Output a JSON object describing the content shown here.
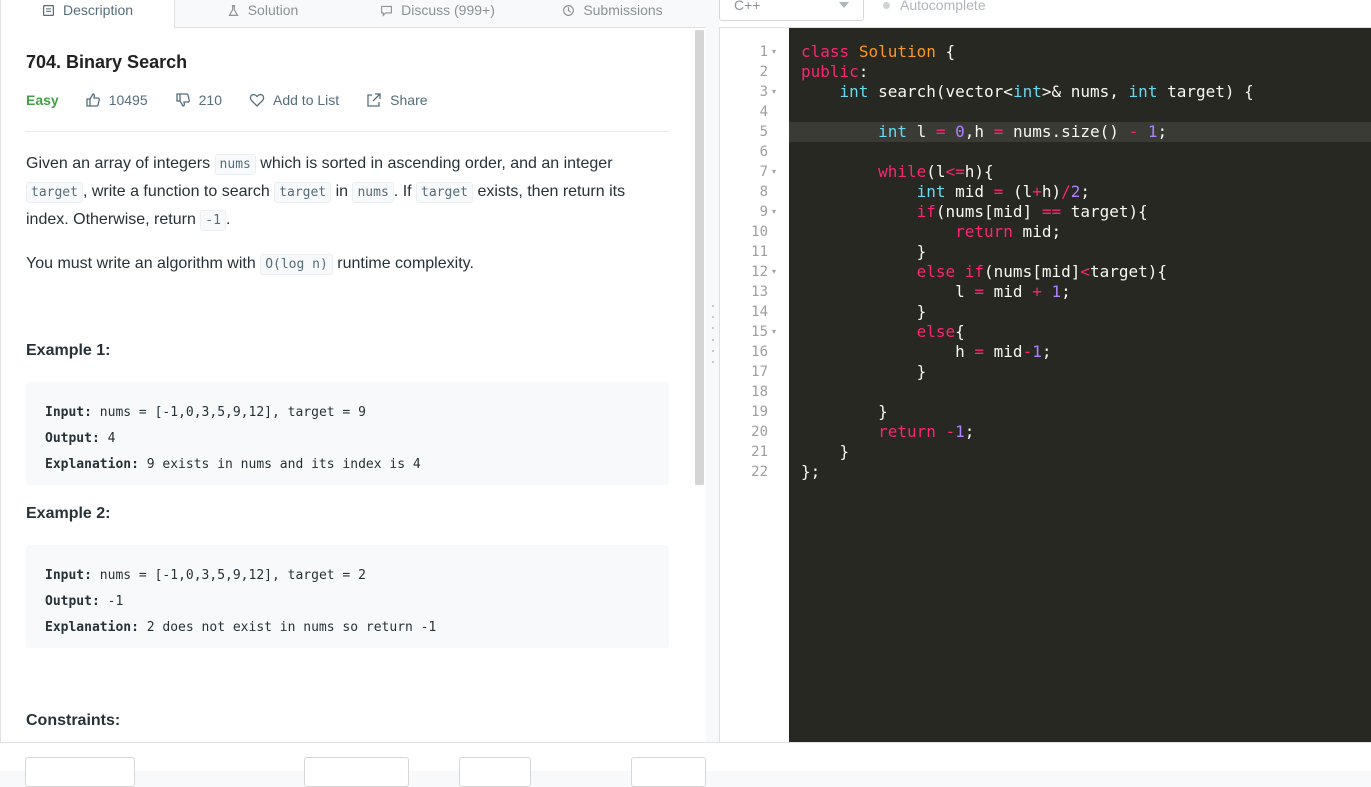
{
  "tabs": [
    {
      "label": "Description",
      "icon": "description-icon"
    },
    {
      "label": "Solution",
      "icon": "flask-icon"
    },
    {
      "label": "Discuss (999+)",
      "icon": "chat-icon"
    },
    {
      "label": "Submissions",
      "icon": "clock-icon"
    }
  ],
  "problem": {
    "title": "704. Binary Search",
    "difficulty": "Easy",
    "likes": "10495",
    "dislikes": "210",
    "add_to_list": "Add to List",
    "share": "Share"
  },
  "description": {
    "p1": [
      {
        "t": "text",
        "v": "Given an array of integers "
      },
      {
        "t": "code",
        "v": "nums"
      },
      {
        "t": "text",
        "v": " which is sorted in ascending order, and an integer "
      },
      {
        "t": "code",
        "v": "target"
      },
      {
        "t": "text",
        "v": ", write a function to search "
      },
      {
        "t": "code",
        "v": "target"
      },
      {
        "t": "text",
        "v": " in "
      },
      {
        "t": "code",
        "v": "nums"
      },
      {
        "t": "text",
        "v": ". If "
      },
      {
        "t": "code",
        "v": "target"
      },
      {
        "t": "text",
        "v": " exists, then return its index. Otherwise, return "
      },
      {
        "t": "code",
        "v": "-1"
      },
      {
        "t": "text",
        "v": "."
      }
    ],
    "p2": [
      {
        "t": "text",
        "v": "You must write an algorithm with "
      },
      {
        "t": "code",
        "v": "O(log n)"
      },
      {
        "t": "text",
        "v": " runtime complexity."
      }
    ]
  },
  "examples": [
    {
      "heading": "Example 1:",
      "input_label": "Input:",
      "input": "nums = [-1,0,3,5,9,12], target = 9",
      "output_label": "Output:",
      "output": "4",
      "explanation_label": "Explanation:",
      "explanation": "9 exists in nums and its index is 4"
    },
    {
      "heading": "Example 2:",
      "input_label": "Input:",
      "input": "nums = [-1,0,3,5,9,12], target = 2",
      "output_label": "Output:",
      "output": "-1",
      "explanation_label": "Explanation:",
      "explanation": "2 does not exist in nums so return -1"
    }
  ],
  "constraints_heading": "Constraints:",
  "editor": {
    "language": "C++",
    "autocomplete": "Autocomplete",
    "highlighted_line": 5,
    "fold_lines": [
      1,
      3,
      7,
      9,
      12,
      15
    ],
    "lines": [
      [
        [
          "kw",
          "class"
        ],
        [
          "t",
          " "
        ],
        [
          "cl",
          "Solution"
        ],
        [
          "t",
          " {"
        ]
      ],
      [
        [
          "kw",
          "public"
        ],
        [
          "t",
          ":"
        ]
      ],
      [
        [
          "t",
          "    "
        ],
        [
          "ty",
          "int"
        ],
        [
          "t",
          " search(vector<"
        ],
        [
          "ty",
          "int"
        ],
        [
          "t",
          ">& nums, "
        ],
        [
          "ty",
          "int"
        ],
        [
          "t",
          " target) {"
        ]
      ],
      [],
      [
        [
          "t",
          "        "
        ],
        [
          "ty",
          "int"
        ],
        [
          "t",
          " l "
        ],
        [
          "op",
          "="
        ],
        [
          "t",
          " "
        ],
        [
          "nu",
          "0"
        ],
        [
          "t",
          ",h "
        ],
        [
          "op",
          "="
        ],
        [
          "t",
          " nums.size() "
        ],
        [
          "op",
          "-"
        ],
        [
          "t",
          " "
        ],
        [
          "nu",
          "1"
        ],
        [
          "t",
          ";"
        ]
      ],
      [],
      [
        [
          "t",
          "        "
        ],
        [
          "kw",
          "while"
        ],
        [
          "t",
          "(l"
        ],
        [
          "op",
          "<="
        ],
        [
          "t",
          "h){"
        ]
      ],
      [
        [
          "t",
          "            "
        ],
        [
          "ty",
          "int"
        ],
        [
          "t",
          " mid "
        ],
        [
          "op",
          "="
        ],
        [
          "t",
          " (l"
        ],
        [
          "op",
          "+"
        ],
        [
          "t",
          "h)"
        ],
        [
          "op",
          "/"
        ],
        [
          "nu",
          "2"
        ],
        [
          "t",
          ";"
        ]
      ],
      [
        [
          "t",
          "            "
        ],
        [
          "kw",
          "if"
        ],
        [
          "t",
          "(nums[mid] "
        ],
        [
          "op",
          "=="
        ],
        [
          "t",
          " target){"
        ]
      ],
      [
        [
          "t",
          "                "
        ],
        [
          "kw",
          "return"
        ],
        [
          "t",
          " mid;"
        ]
      ],
      [
        [
          "t",
          "            }"
        ]
      ],
      [
        [
          "t",
          "            "
        ],
        [
          "kw",
          "else"
        ],
        [
          "t",
          " "
        ],
        [
          "kw",
          "if"
        ],
        [
          "t",
          "(nums[mid]"
        ],
        [
          "op",
          "<"
        ],
        [
          "t",
          "target){"
        ]
      ],
      [
        [
          "t",
          "                l "
        ],
        [
          "op",
          "="
        ],
        [
          "t",
          " mid "
        ],
        [
          "op",
          "+"
        ],
        [
          "t",
          " "
        ],
        [
          "nu",
          "1"
        ],
        [
          "t",
          ";"
        ]
      ],
      [
        [
          "t",
          "            }"
        ]
      ],
      [
        [
          "t",
          "            "
        ],
        [
          "kw",
          "else"
        ],
        [
          "t",
          "{"
        ]
      ],
      [
        [
          "t",
          "                h "
        ],
        [
          "op",
          "="
        ],
        [
          "t",
          " mid"
        ],
        [
          "op",
          "-"
        ],
        [
          "nu",
          "1"
        ],
        [
          "t",
          ";"
        ]
      ],
      [
        [
          "t",
          "            }"
        ]
      ],
      [],
      [
        [
          "t",
          "        }"
        ]
      ],
      [
        [
          "t",
          "        "
        ],
        [
          "kw",
          "return"
        ],
        [
          "t",
          " "
        ],
        [
          "op",
          "-"
        ],
        [
          "nu",
          "1"
        ],
        [
          "t",
          ";"
        ]
      ],
      [
        [
          "t",
          "    }"
        ]
      ],
      [
        [
          "t",
          "};"
        ]
      ]
    ]
  }
}
